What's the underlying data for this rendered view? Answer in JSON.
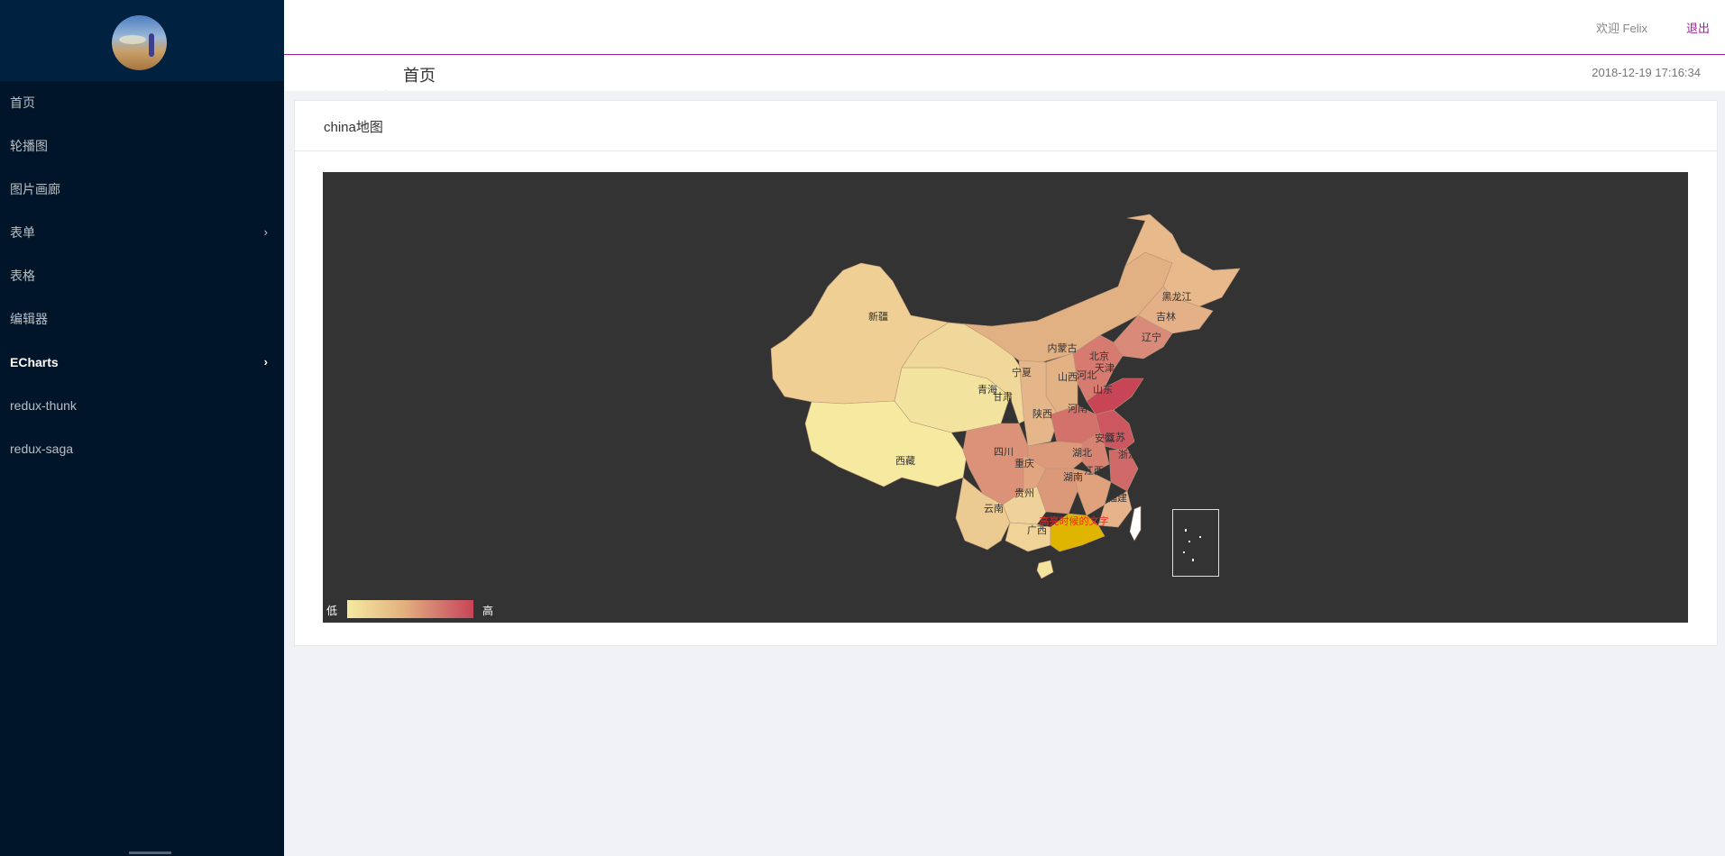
{
  "sidebar": {
    "items": [
      {
        "label": "首页",
        "has_arrow": false,
        "active": false,
        "name": "sidebar-item-home"
      },
      {
        "label": "轮播图",
        "has_arrow": false,
        "active": false,
        "name": "sidebar-item-carousel"
      },
      {
        "label": "图片画廊",
        "has_arrow": false,
        "active": false,
        "name": "sidebar-item-gallery"
      },
      {
        "label": "表单",
        "has_arrow": true,
        "active": false,
        "name": "sidebar-item-form"
      },
      {
        "label": "表格",
        "has_arrow": false,
        "active": false,
        "name": "sidebar-item-table"
      },
      {
        "label": "编辑器",
        "has_arrow": false,
        "active": false,
        "name": "sidebar-item-editor"
      },
      {
        "label": "ECharts",
        "has_arrow": true,
        "active": true,
        "name": "sidebar-item-echarts"
      },
      {
        "label": "redux-thunk",
        "has_arrow": false,
        "active": false,
        "name": "sidebar-item-redux-thunk"
      },
      {
        "label": "redux-saga",
        "has_arrow": false,
        "active": false,
        "name": "sidebar-item-redux-saga"
      }
    ]
  },
  "header": {
    "welcome": "欢迎 Felix",
    "logout": "退出"
  },
  "breadcrumb": {
    "label": "首页",
    "datetime": "2018-12-19 17:16:34"
  },
  "card": {
    "title": "china地图"
  },
  "chart_data": {
    "type": "map",
    "map": "china",
    "highlighted_province": "广东",
    "highlight_label": "高亮时候的文字",
    "visual_map": {
      "low": "低",
      "high": "高",
      "colors": [
        "#f6eaa0",
        "#e2b07e",
        "#d06a6a",
        "#c84556"
      ]
    },
    "provinces": [
      "新疆",
      "西藏",
      "青海",
      "甘肃",
      "宁夏",
      "内蒙古",
      "黑龙江",
      "吉林",
      "辽宁",
      "北京",
      "天津",
      "河北",
      "山西",
      "山东",
      "陕西",
      "河南",
      "四川",
      "重庆",
      "湖北",
      "安徽",
      "江苏",
      "浙江",
      "江西",
      "湖南",
      "贵州",
      "云南",
      "广西",
      "福建"
    ],
    "colors": {
      "background": "#333333",
      "highlight": "#e0b500",
      "highlight_text": "#ff2020",
      "region_text": "#333333"
    }
  }
}
